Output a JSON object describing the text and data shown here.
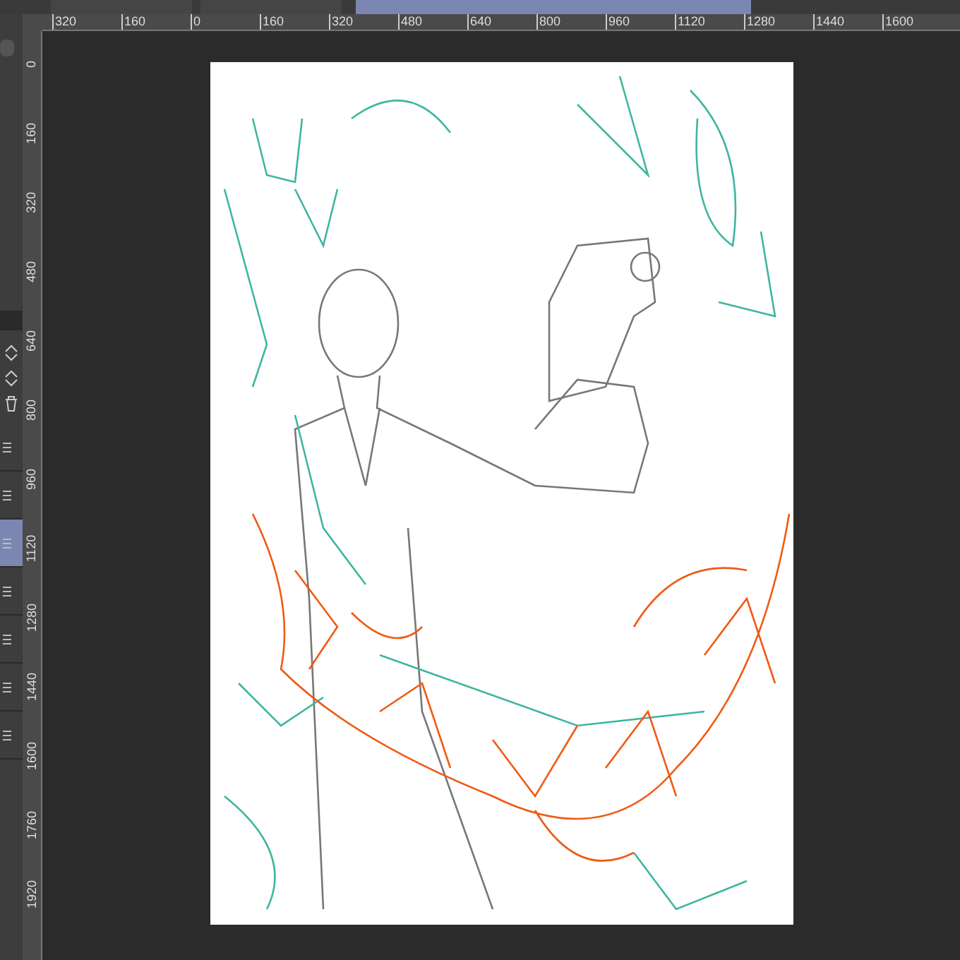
{
  "tabs": [
    {
      "selected": false
    },
    {
      "selected": false
    },
    {
      "selected": true
    }
  ],
  "ruler_top": {
    "labels": [
      "320",
      "160",
      "0",
      "160",
      "320",
      "480",
      "640",
      "800",
      "960",
      "1120",
      "1280",
      "1440",
      "1600"
    ]
  },
  "ruler_left": {
    "labels": [
      "0",
      "160",
      "320",
      "480",
      "640",
      "800",
      "960",
      "1120",
      "1280",
      "1440",
      "1600",
      "1760",
      "1920"
    ]
  },
  "layer_rows": [
    {
      "selected": false
    },
    {
      "selected": false
    },
    {
      "selected": true
    },
    {
      "selected": false
    },
    {
      "selected": false
    },
    {
      "selected": false
    },
    {
      "selected": false
    }
  ]
}
